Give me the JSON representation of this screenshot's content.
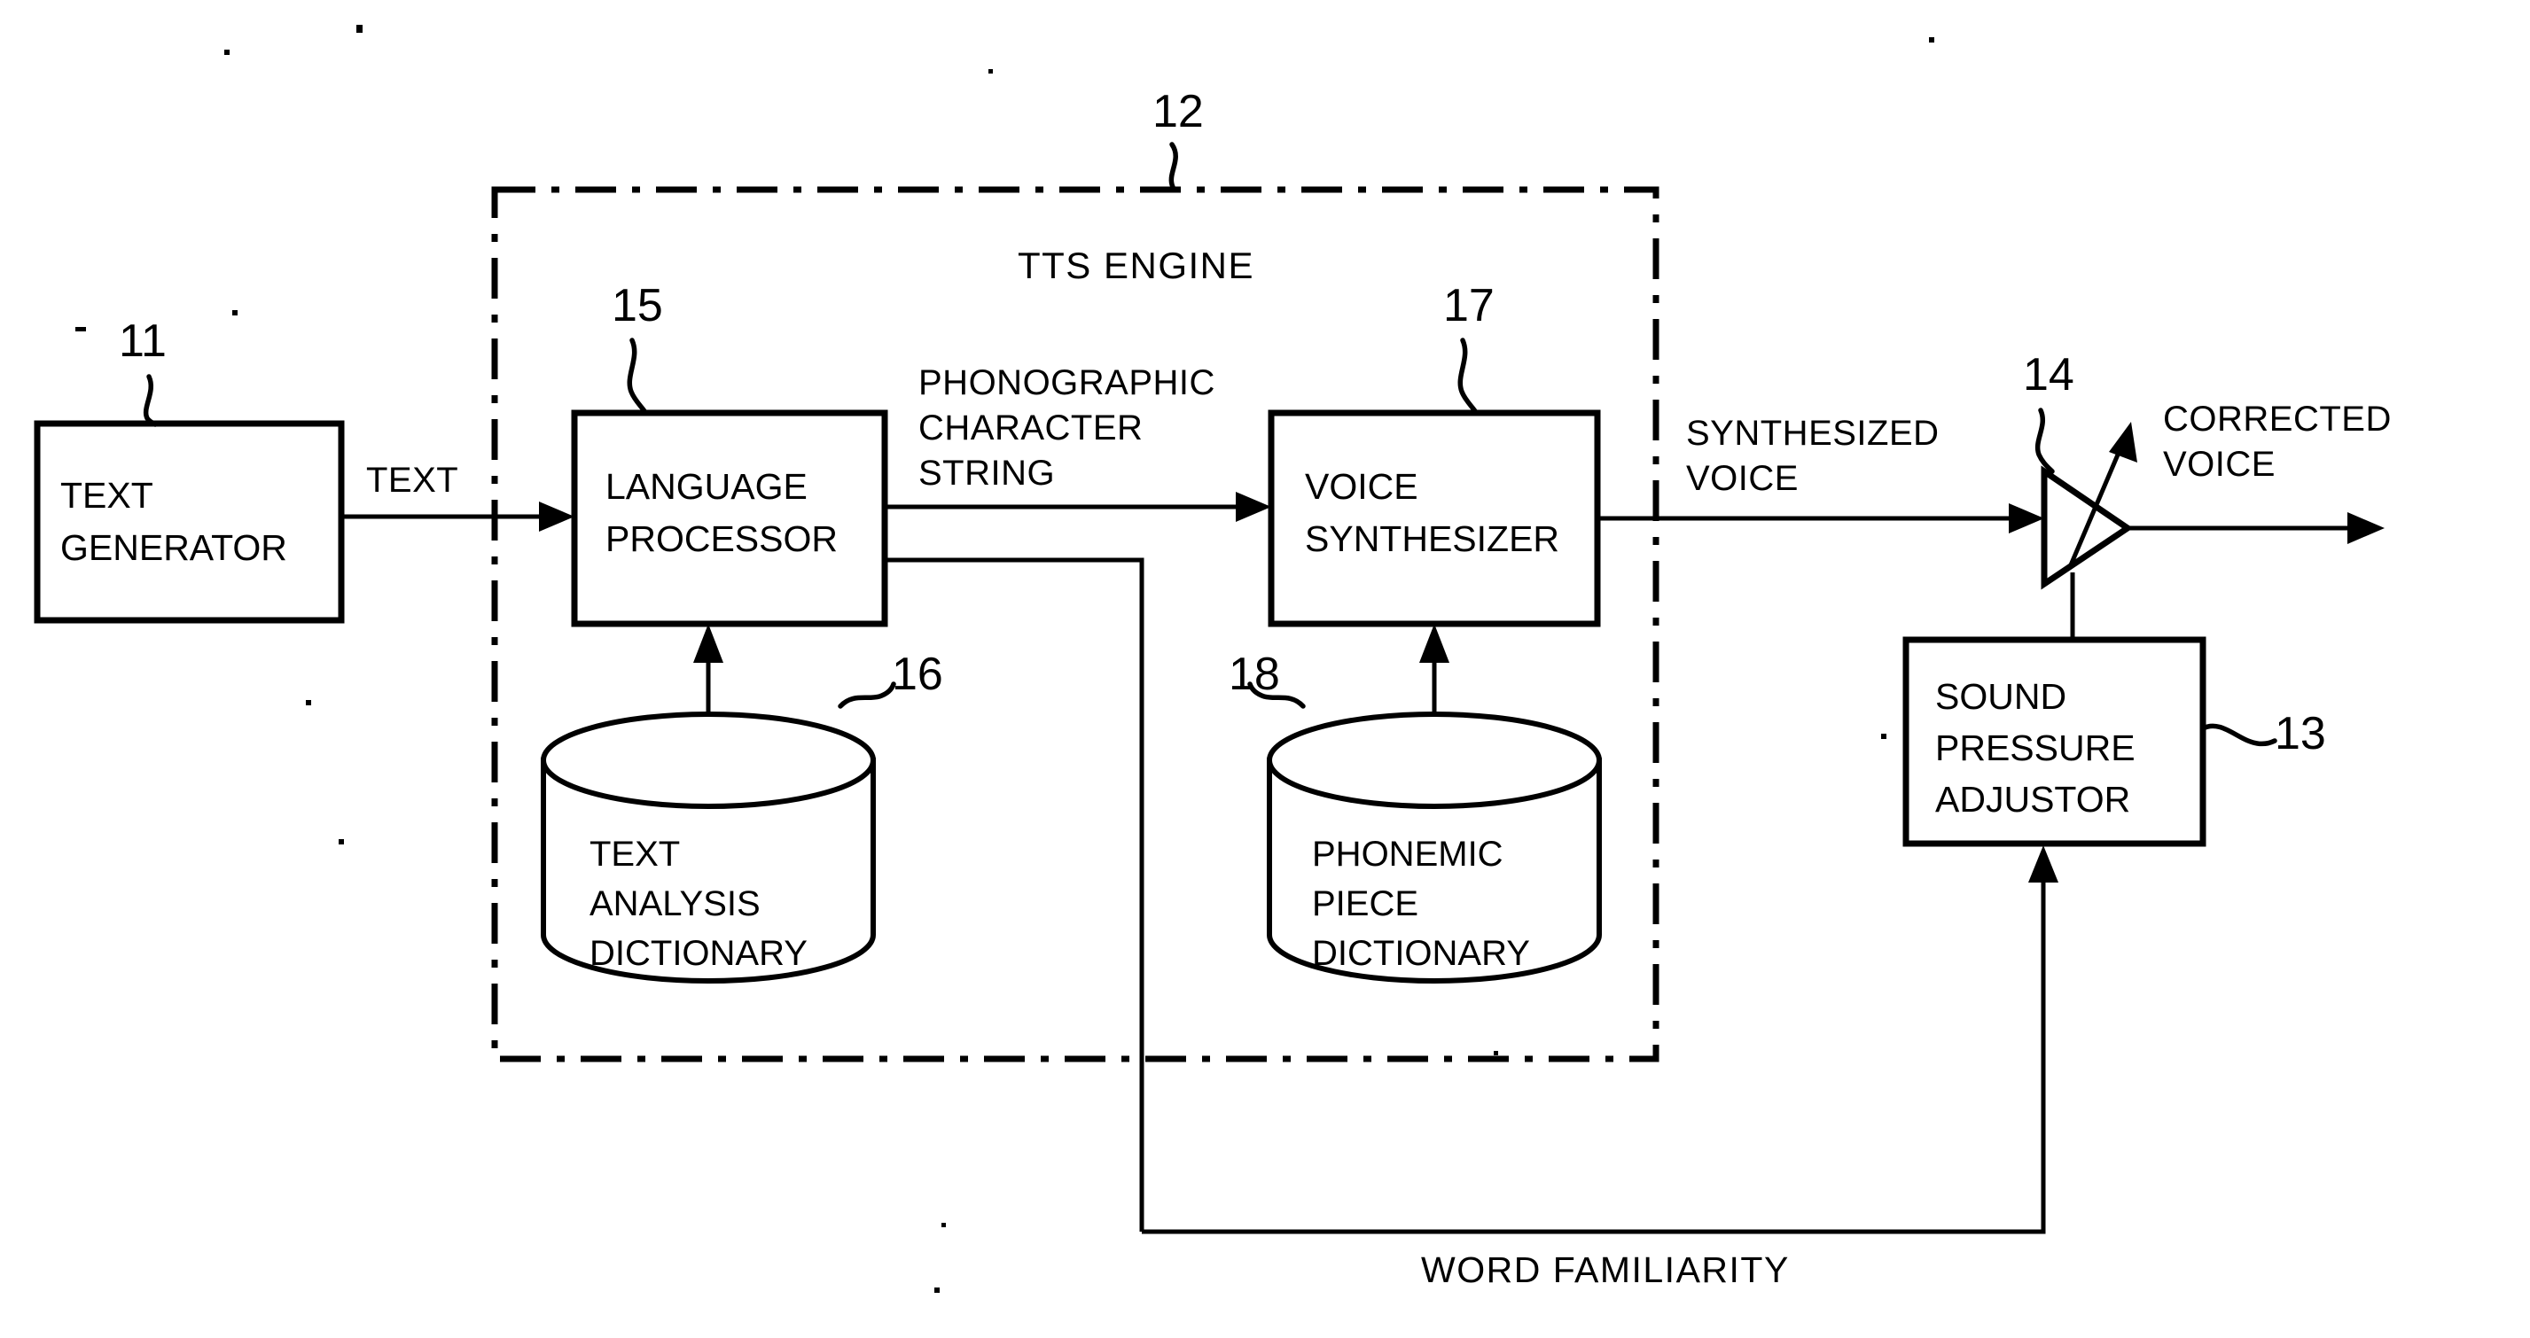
{
  "figure": {
    "type": "block-diagram",
    "title_text": "TTS ENGINE",
    "background": "#ffffff",
    "ink": "#000000"
  },
  "blocks": {
    "text_generator": {
      "label_line1": "TEXT",
      "label_line2": "GENERATOR",
      "ref": "11"
    },
    "language_processor": {
      "label_line1": "LANGUAGE",
      "label_line2": "PROCESSOR",
      "ref": "15"
    },
    "voice_synthesizer": {
      "label_line1": "VOICE",
      "label_line2": "SYNTHESIZER",
      "ref": "17"
    },
    "sound_pressure_adjustor": {
      "label_line1": "SOUND",
      "label_line2": "PRESSURE",
      "label_line3": "ADJUSTOR",
      "ref": "13"
    },
    "text_analysis_dictionary": {
      "label_line1": "TEXT",
      "label_line2": "ANALYSIS",
      "label_line3": "DICTIONARY",
      "ref": "16"
    },
    "phonemic_piece_dictionary": {
      "label_line1": "PHONEMIC",
      "label_line2": "PIECE",
      "label_line3": "DICTIONARY",
      "ref": "18"
    },
    "amplifier": {
      "ref": "14"
    },
    "tts_engine_boundary": {
      "label": "TTS  ENGINE",
      "ref": "12"
    }
  },
  "signals": {
    "text": "TEXT",
    "phonographic_character_string_line1": "PHONOGRAPHIC",
    "phonographic_character_string_line2": "CHARACTER",
    "phonographic_character_string_line3": "STRING",
    "synthesized_voice_line1": "SYNTHESIZED",
    "synthesized_voice_line2": "VOICE",
    "corrected_voice_line1": "CORRECTED",
    "corrected_voice_line2": "VOICE",
    "word_familiarity": "WORD  FAMILIARITY"
  }
}
